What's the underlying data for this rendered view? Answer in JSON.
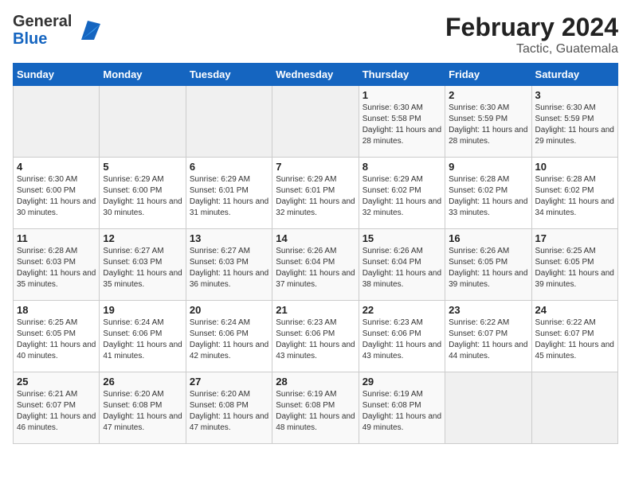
{
  "header": {
    "logo_general": "General",
    "logo_blue": "Blue",
    "main_title": "February 2024",
    "subtitle": "Tactic, Guatemala"
  },
  "days_of_week": [
    "Sunday",
    "Monday",
    "Tuesday",
    "Wednesday",
    "Thursday",
    "Friday",
    "Saturday"
  ],
  "weeks": [
    [
      {
        "day": "",
        "info": ""
      },
      {
        "day": "",
        "info": ""
      },
      {
        "day": "",
        "info": ""
      },
      {
        "day": "",
        "info": ""
      },
      {
        "day": "1",
        "info": "Sunrise: 6:30 AM\nSunset: 5:58 PM\nDaylight: 11 hours and 28 minutes."
      },
      {
        "day": "2",
        "info": "Sunrise: 6:30 AM\nSunset: 5:59 PM\nDaylight: 11 hours and 28 minutes."
      },
      {
        "day": "3",
        "info": "Sunrise: 6:30 AM\nSunset: 5:59 PM\nDaylight: 11 hours and 29 minutes."
      }
    ],
    [
      {
        "day": "4",
        "info": "Sunrise: 6:30 AM\nSunset: 6:00 PM\nDaylight: 11 hours and 30 minutes."
      },
      {
        "day": "5",
        "info": "Sunrise: 6:29 AM\nSunset: 6:00 PM\nDaylight: 11 hours and 30 minutes."
      },
      {
        "day": "6",
        "info": "Sunrise: 6:29 AM\nSunset: 6:01 PM\nDaylight: 11 hours and 31 minutes."
      },
      {
        "day": "7",
        "info": "Sunrise: 6:29 AM\nSunset: 6:01 PM\nDaylight: 11 hours and 32 minutes."
      },
      {
        "day": "8",
        "info": "Sunrise: 6:29 AM\nSunset: 6:02 PM\nDaylight: 11 hours and 32 minutes."
      },
      {
        "day": "9",
        "info": "Sunrise: 6:28 AM\nSunset: 6:02 PM\nDaylight: 11 hours and 33 minutes."
      },
      {
        "day": "10",
        "info": "Sunrise: 6:28 AM\nSunset: 6:02 PM\nDaylight: 11 hours and 34 minutes."
      }
    ],
    [
      {
        "day": "11",
        "info": "Sunrise: 6:28 AM\nSunset: 6:03 PM\nDaylight: 11 hours and 35 minutes."
      },
      {
        "day": "12",
        "info": "Sunrise: 6:27 AM\nSunset: 6:03 PM\nDaylight: 11 hours and 35 minutes."
      },
      {
        "day": "13",
        "info": "Sunrise: 6:27 AM\nSunset: 6:03 PM\nDaylight: 11 hours and 36 minutes."
      },
      {
        "day": "14",
        "info": "Sunrise: 6:26 AM\nSunset: 6:04 PM\nDaylight: 11 hours and 37 minutes."
      },
      {
        "day": "15",
        "info": "Sunrise: 6:26 AM\nSunset: 6:04 PM\nDaylight: 11 hours and 38 minutes."
      },
      {
        "day": "16",
        "info": "Sunrise: 6:26 AM\nSunset: 6:05 PM\nDaylight: 11 hours and 39 minutes."
      },
      {
        "day": "17",
        "info": "Sunrise: 6:25 AM\nSunset: 6:05 PM\nDaylight: 11 hours and 39 minutes."
      }
    ],
    [
      {
        "day": "18",
        "info": "Sunrise: 6:25 AM\nSunset: 6:05 PM\nDaylight: 11 hours and 40 minutes."
      },
      {
        "day": "19",
        "info": "Sunrise: 6:24 AM\nSunset: 6:06 PM\nDaylight: 11 hours and 41 minutes."
      },
      {
        "day": "20",
        "info": "Sunrise: 6:24 AM\nSunset: 6:06 PM\nDaylight: 11 hours and 42 minutes."
      },
      {
        "day": "21",
        "info": "Sunrise: 6:23 AM\nSunset: 6:06 PM\nDaylight: 11 hours and 43 minutes."
      },
      {
        "day": "22",
        "info": "Sunrise: 6:23 AM\nSunset: 6:06 PM\nDaylight: 11 hours and 43 minutes."
      },
      {
        "day": "23",
        "info": "Sunrise: 6:22 AM\nSunset: 6:07 PM\nDaylight: 11 hours and 44 minutes."
      },
      {
        "day": "24",
        "info": "Sunrise: 6:22 AM\nSunset: 6:07 PM\nDaylight: 11 hours and 45 minutes."
      }
    ],
    [
      {
        "day": "25",
        "info": "Sunrise: 6:21 AM\nSunset: 6:07 PM\nDaylight: 11 hours and 46 minutes."
      },
      {
        "day": "26",
        "info": "Sunrise: 6:20 AM\nSunset: 6:08 PM\nDaylight: 11 hours and 47 minutes."
      },
      {
        "day": "27",
        "info": "Sunrise: 6:20 AM\nSunset: 6:08 PM\nDaylight: 11 hours and 47 minutes."
      },
      {
        "day": "28",
        "info": "Sunrise: 6:19 AM\nSunset: 6:08 PM\nDaylight: 11 hours and 48 minutes."
      },
      {
        "day": "29",
        "info": "Sunrise: 6:19 AM\nSunset: 6:08 PM\nDaylight: 11 hours and 49 minutes."
      },
      {
        "day": "",
        "info": ""
      },
      {
        "day": "",
        "info": ""
      }
    ]
  ]
}
